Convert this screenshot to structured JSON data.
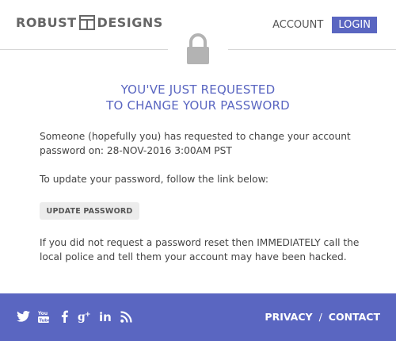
{
  "header": {
    "logo_left": "ROBUST",
    "logo_right": "DESIGNS",
    "account_label": "ACCOUNT",
    "login_label": "LOGIN"
  },
  "main": {
    "title_line1": "YOU'VE JUST REQUESTED",
    "title_line2": "TO CHANGE YOUR PASSWORD",
    "paragraph1": "Someone (hopefully you) has requested to change your account password on: 28-NOV-2016 3:00AM PST",
    "paragraph2": "To update your password, follow the link below:",
    "button_label": "UPDATE PASSWORD",
    "paragraph3": "If you did not request a password reset then IMMEDIATELY call the local police and tell them your account may have been hacked."
  },
  "footer": {
    "social_icons": [
      "twitter-icon",
      "youtube-icon",
      "facebook-icon",
      "google-plus-icon",
      "linkedin-icon",
      "rss-icon"
    ],
    "privacy_label": "PRIVACY",
    "separator": "/",
    "contact_label": "CONTACT"
  },
  "colors": {
    "accent": "#5a66c1",
    "divider": "#d6d6d6",
    "lock": "#b3b3b3",
    "button_bg": "#ececec"
  }
}
